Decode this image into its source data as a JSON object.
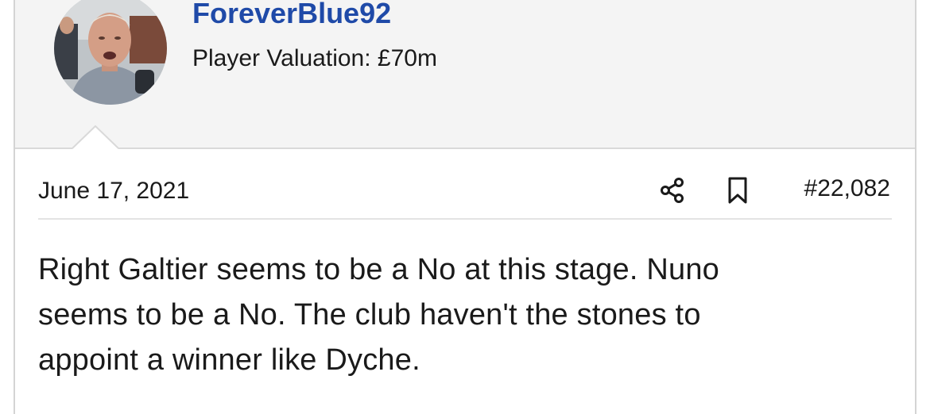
{
  "user": {
    "username": "ForeverBlue92",
    "valuation": "Player Valuation: £70m",
    "avatar_icon": "user-avatar-photo"
  },
  "post": {
    "date": "June 17, 2021",
    "number": "#22,082",
    "share_icon": "share-icon",
    "bookmark_icon": "bookmark-icon",
    "body_lines": [
      "Right Galtier seems to be a No at this stage. Nuno",
      "seems to be a No. The club haven't the stones to",
      "appoint a winner like Dyche."
    ]
  },
  "colors": {
    "username": "#1f4aa8",
    "header_bg": "#f4f4f4",
    "text": "#1a1a1a"
  }
}
